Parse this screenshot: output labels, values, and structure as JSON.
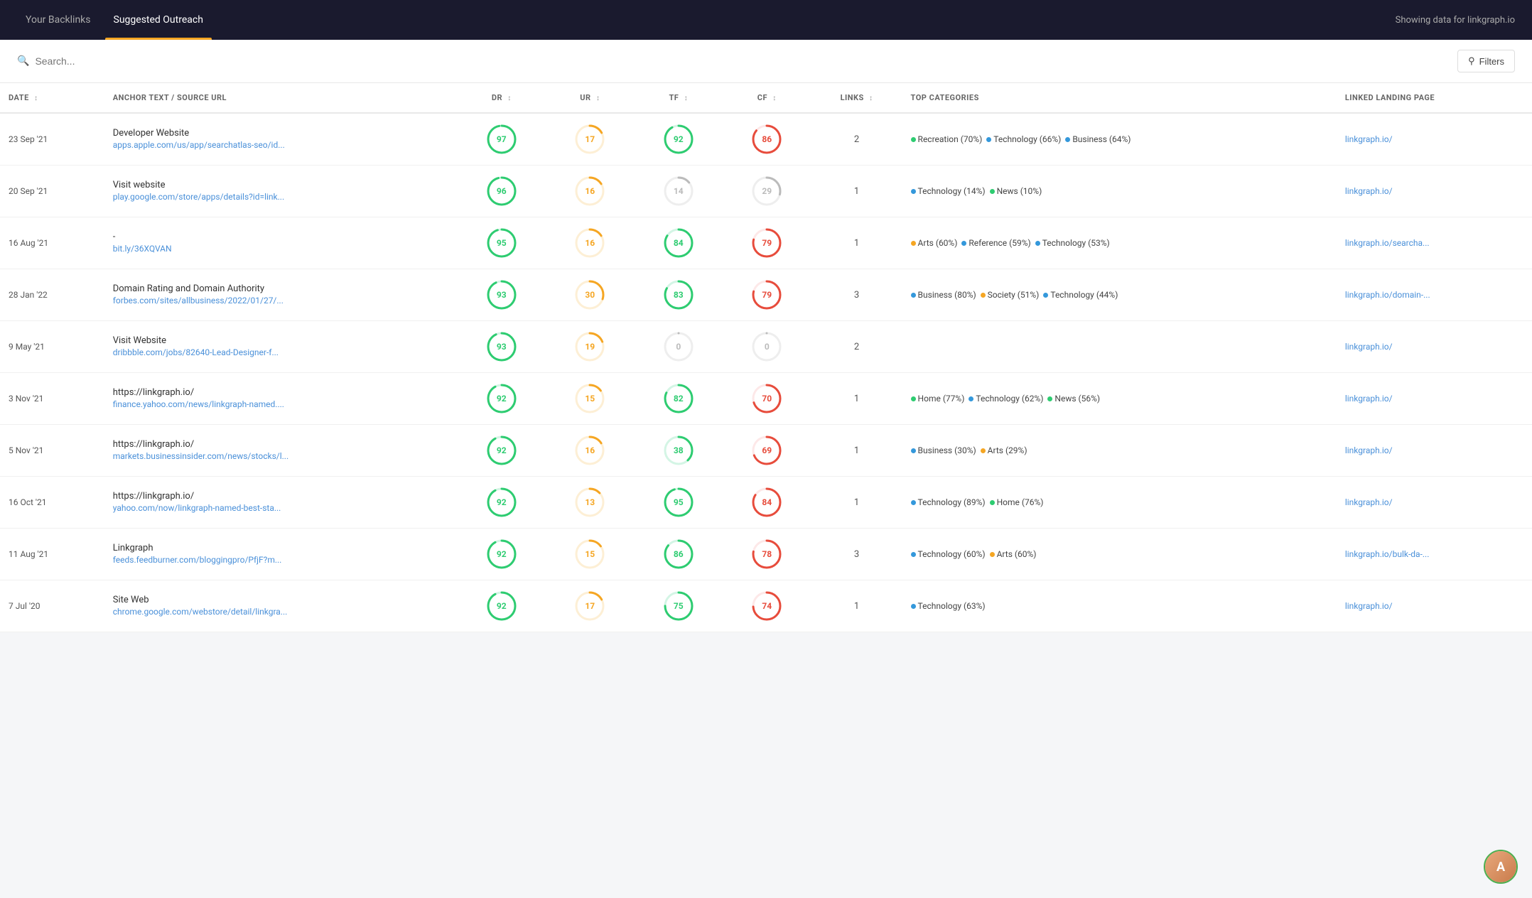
{
  "nav": {
    "tabs": [
      {
        "id": "your-backlinks",
        "label": "Your Backlinks",
        "active": false
      },
      {
        "id": "suggested-outreach",
        "label": "Suggested Outreach",
        "active": true
      }
    ],
    "showing": "Showing data for linkgraph.io"
  },
  "search": {
    "placeholder": "Search...",
    "filters_label": "Filters"
  },
  "table": {
    "columns": [
      {
        "id": "date",
        "label": "DATE"
      },
      {
        "id": "anchor",
        "label": "ANCHOR TEXT / SOURCE URL"
      },
      {
        "id": "dr",
        "label": "DR"
      },
      {
        "id": "ur",
        "label": "UR"
      },
      {
        "id": "tf",
        "label": "TF"
      },
      {
        "id": "cf",
        "label": "CF"
      },
      {
        "id": "links",
        "label": "LINKS"
      },
      {
        "id": "top_categories",
        "label": "TOP CATEGORIES"
      },
      {
        "id": "linked_page",
        "label": "LINKED LANDING PAGE"
      }
    ],
    "rows": [
      {
        "date": "23 Sep '21",
        "anchor_title": "Developer Website",
        "anchor_url": "apps.apple.com/us/app/searchatlas-seo/id...",
        "dr": 97,
        "dr_color": "#2ecc71",
        "dr_track": "#d4f5e5",
        "ur": 17,
        "ur_color": "#f5a623",
        "ur_track": "#fdefd5",
        "tf": 92,
        "tf_color": "#2ecc71",
        "tf_track": "#d4f5e5",
        "cf": 86,
        "cf_color": "#e74c3c",
        "cf_track": "#fde8e8",
        "links": 2,
        "categories": [
          {
            "name": "Recreation (70%)",
            "color": "#2ecc71"
          },
          {
            "name": "Technology (66%)",
            "color": "#3498db"
          },
          {
            "name": "Business (64%)",
            "color": "#3498db"
          }
        ],
        "linked_page": "linkgraph.io/"
      },
      {
        "date": "20 Sep '21",
        "anchor_title": "Visit website",
        "anchor_url": "play.google.com/store/apps/details?id=link...",
        "dr": 96,
        "dr_color": "#2ecc71",
        "dr_track": "#d4f5e5",
        "ur": 16,
        "ur_color": "#f5a623",
        "ur_track": "#fdefd5",
        "tf": 14,
        "tf_color": "#bbb",
        "tf_track": "#eee",
        "cf": 29,
        "cf_color": "#bbb",
        "cf_track": "#eee",
        "links": 1,
        "categories": [
          {
            "name": "Technology (14%)",
            "color": "#3498db"
          },
          {
            "name": "News (10%)",
            "color": "#2ecc71"
          }
        ],
        "linked_page": "linkgraph.io/"
      },
      {
        "date": "16 Aug '21",
        "anchor_title": "-",
        "anchor_url": "bit.ly/36XQVAN",
        "dr": 95,
        "dr_color": "#2ecc71",
        "dr_track": "#d4f5e5",
        "ur": 16,
        "ur_color": "#f5a623",
        "ur_track": "#fdefd5",
        "tf": 84,
        "tf_color": "#2ecc71",
        "tf_track": "#d4f5e5",
        "cf": 79,
        "cf_color": "#e74c3c",
        "cf_track": "#fde8e8",
        "links": 1,
        "categories": [
          {
            "name": "Arts (60%)",
            "color": "#f5a623"
          },
          {
            "name": "Reference (59%)",
            "color": "#3498db"
          },
          {
            "name": "Technology (53%)",
            "color": "#3498db"
          }
        ],
        "linked_page": "linkgraph.io/searcha..."
      },
      {
        "date": "28 Jan '22",
        "anchor_title": "Domain Rating and Domain Authority",
        "anchor_url": "forbes.com/sites/allbusiness/2022/01/27/...",
        "dr": 93,
        "dr_color": "#2ecc71",
        "dr_track": "#d4f5e5",
        "ur": 30,
        "ur_color": "#f5a623",
        "ur_track": "#fdefd5",
        "tf": 83,
        "tf_color": "#2ecc71",
        "tf_track": "#d4f5e5",
        "cf": 79,
        "cf_color": "#e74c3c",
        "cf_track": "#fde8e8",
        "links": 3,
        "categories": [
          {
            "name": "Business (80%)",
            "color": "#3498db"
          },
          {
            "name": "Society (51%)",
            "color": "#f5a623"
          },
          {
            "name": "Technology (44%)",
            "color": "#3498db"
          }
        ],
        "linked_page": "linkgraph.io/domain-..."
      },
      {
        "date": "9 May '21",
        "anchor_title": "Visit Website",
        "anchor_url": "dribbble.com/jobs/82640-Lead-Designer-f...",
        "dr": 93,
        "dr_color": "#2ecc71",
        "dr_track": "#d4f5e5",
        "ur": 19,
        "ur_color": "#f5a623",
        "ur_track": "#fdefd5",
        "tf": 0,
        "tf_color": "#bbb",
        "tf_track": "#eee",
        "cf": 0,
        "cf_color": "#bbb",
        "cf_track": "#eee",
        "links": 2,
        "categories": [],
        "linked_page": "linkgraph.io/"
      },
      {
        "date": "3 Nov '21",
        "anchor_title": "https://linkgraph.io/",
        "anchor_url": "finance.yahoo.com/news/linkgraph-named....",
        "dr": 92,
        "dr_color": "#2ecc71",
        "dr_track": "#d4f5e5",
        "ur": 15,
        "ur_color": "#f5a623",
        "ur_track": "#fdefd5",
        "tf": 82,
        "tf_color": "#2ecc71",
        "tf_track": "#d4f5e5",
        "cf": 70,
        "cf_color": "#e74c3c",
        "cf_track": "#fde8e8",
        "links": 1,
        "categories": [
          {
            "name": "Home (77%)",
            "color": "#2ecc71"
          },
          {
            "name": "Technology (62%)",
            "color": "#3498db"
          },
          {
            "name": "News (56%)",
            "color": "#2ecc71"
          }
        ],
        "linked_page": "linkgraph.io/"
      },
      {
        "date": "5 Nov '21",
        "anchor_title": "https://linkgraph.io/",
        "anchor_url": "markets.businessinsider.com/news/stocks/l...",
        "dr": 92,
        "dr_color": "#2ecc71",
        "dr_track": "#d4f5e5",
        "ur": 16,
        "ur_color": "#f5a623",
        "ur_track": "#fdefd5",
        "tf": 38,
        "tf_color": "#2ecc71",
        "tf_track": "#d4f5e5",
        "cf": 69,
        "cf_color": "#e74c3c",
        "cf_track": "#fde8e8",
        "links": 1,
        "categories": [
          {
            "name": "Business (30%)",
            "color": "#3498db"
          },
          {
            "name": "Arts (29%)",
            "color": "#f5a623"
          }
        ],
        "linked_page": "linkgraph.io/"
      },
      {
        "date": "16 Oct '21",
        "anchor_title": "https://linkgraph.io/",
        "anchor_url": "yahoo.com/now/linkgraph-named-best-sta...",
        "dr": 92,
        "dr_color": "#2ecc71",
        "dr_track": "#d4f5e5",
        "ur": 13,
        "ur_color": "#f5a623",
        "ur_track": "#fdefd5",
        "tf": 95,
        "tf_color": "#2ecc71",
        "tf_track": "#d4f5e5",
        "cf": 84,
        "cf_color": "#e74c3c",
        "cf_track": "#fde8e8",
        "links": 1,
        "categories": [
          {
            "name": "Technology (89%)",
            "color": "#3498db"
          },
          {
            "name": "Home (76%)",
            "color": "#2ecc71"
          }
        ],
        "linked_page": "linkgraph.io/"
      },
      {
        "date": "11 Aug '21",
        "anchor_title": "Linkgraph",
        "anchor_url": "feeds.feedburner.com/bloggingpro/PfjF?m...",
        "dr": 92,
        "dr_color": "#2ecc71",
        "dr_track": "#d4f5e5",
        "ur": 15,
        "ur_color": "#f5a623",
        "ur_track": "#fdefd5",
        "tf": 86,
        "tf_color": "#2ecc71",
        "tf_track": "#d4f5e5",
        "cf": 78,
        "cf_color": "#e74c3c",
        "cf_track": "#fde8e8",
        "links": 3,
        "categories": [
          {
            "name": "Technology (60%)",
            "color": "#3498db"
          },
          {
            "name": "Arts (60%)",
            "color": "#f5a623"
          }
        ],
        "linked_page": "linkgraph.io/bulk-da-..."
      },
      {
        "date": "7 Jul '20",
        "anchor_title": "Site Web",
        "anchor_url": "chrome.google.com/webstore/detail/linkgra...",
        "dr": 92,
        "dr_color": "#2ecc71",
        "dr_track": "#d4f5e5",
        "ur": 17,
        "ur_color": "#f5a623",
        "ur_track": "#fdefd5",
        "tf": 75,
        "tf_color": "#2ecc71",
        "tf_track": "#d4f5e5",
        "cf": 74,
        "cf_color": "#e74c3c",
        "cf_track": "#fde8e8",
        "links": 1,
        "categories": [
          {
            "name": "Technology (63%)",
            "color": "#3498db"
          }
        ],
        "linked_page": "linkgraph.io/"
      }
    ]
  }
}
